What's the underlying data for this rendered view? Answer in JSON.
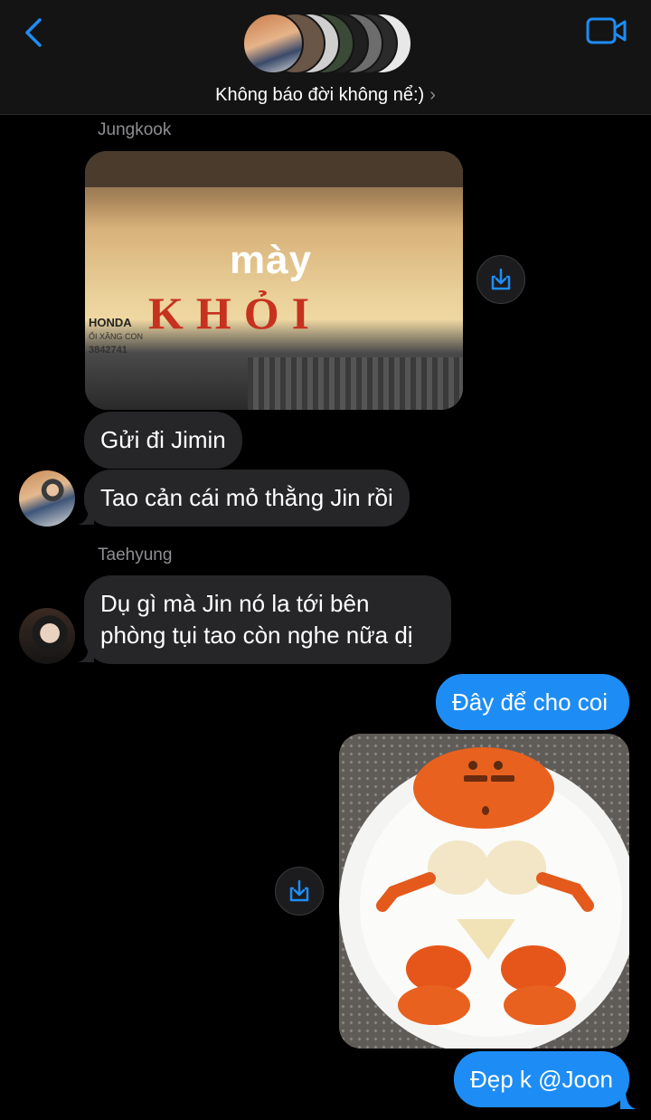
{
  "header": {
    "group_title": "Không báo đời không nể:)",
    "chevron": "›",
    "back_icon": "chevron-left-icon",
    "video_icon": "video-camera-icon",
    "accent": "#1d8df5"
  },
  "messages": {
    "sender_1": "Jungkook",
    "m1_photo_caption": "mày",
    "m1_photo_sign": "KHỎI",
    "m1_photo_sign_small_1": "HONDA",
    "m1_photo_sign_small_2": "ỔI XĂNG CON",
    "m1_photo_sign_small_3": "3842741",
    "m2": "Gửi đi Jimin",
    "m3": "Tao cản cái mỏ thằng Jin rồi",
    "sender_2": "Taehyung",
    "m4_line1": "Dụ gì mà Jin nó la tới bên",
    "m4_line2": "phòng tụi tao còn nghe nữa dị",
    "m5": "Đây để cho coi",
    "m7": "Đẹp k @Joon"
  }
}
